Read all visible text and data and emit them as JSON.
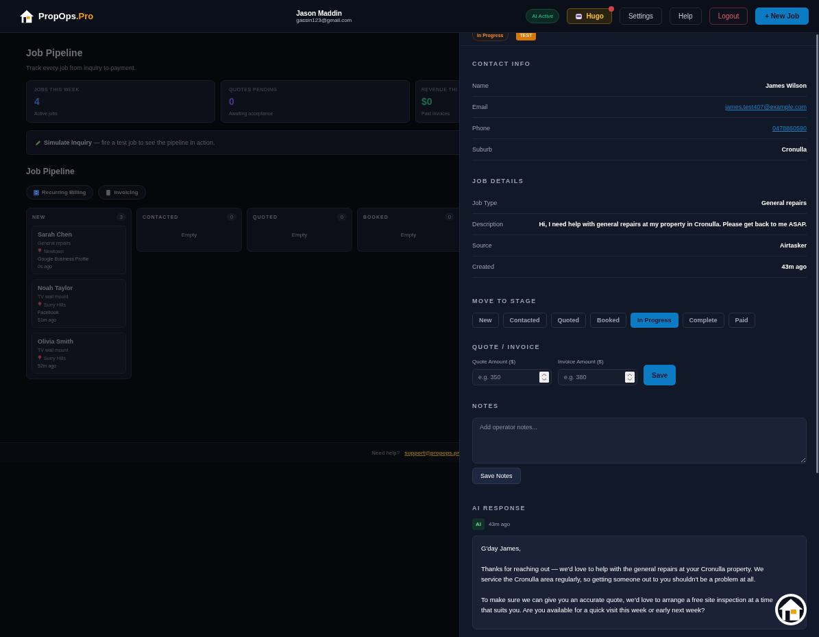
{
  "header": {
    "brand": {
      "name": "PropOps",
      "suffix": ".Pro"
    },
    "user": {
      "name": "Jason Maddin",
      "email": "gassin123@gmail.com"
    },
    "ai_status": "AI Active",
    "assistant": {
      "label": "Hugo",
      "notification": true
    },
    "buttons": [
      {
        "label": "Settings",
        "kind": "plain"
      },
      {
        "label": "Help",
        "kind": "plain"
      },
      {
        "label": "Logout",
        "kind": "danger"
      },
      {
        "label": "+ New Job",
        "kind": "primary"
      }
    ]
  },
  "page": {
    "title": "Job Pipeline",
    "subtitle": "Track every job from inquiry to payment.",
    "stats": [
      {
        "label": "JOBS THIS WEEK",
        "value": "4",
        "caption": "Active jobs",
        "color": "#2a4a8c"
      },
      {
        "label": "QUOTES PENDING",
        "value": "0",
        "caption": "Awaiting acceptance",
        "color": "#4a3590"
      },
      {
        "label": "REVENUE THI",
        "value": "$0",
        "caption": "Paid invoices",
        "color": "#1e6a4a"
      }
    ],
    "simulate": {
      "title": "Simulate Inquiry",
      "text": " — fire a test job to see the pipeline in action."
    },
    "pipeline_title": "Job Pipeline",
    "tabs": [
      {
        "label": "Recurring Billing",
        "kind": "billing"
      },
      {
        "label": "Invoicing",
        "kind": "invoice"
      }
    ],
    "columns": [
      {
        "name": "NEW",
        "count": "3",
        "cards": [
          {
            "name": "Sarah Chen",
            "job_type": "General repairs",
            "suburb": "Newtown",
            "source": "Google Business Profile",
            "time": "0s ago"
          },
          {
            "name": "Noah Taylor",
            "job_type": "TV wall mount",
            "suburb": "Surry Hills",
            "source": "Facebook",
            "time": "51m ago"
          },
          {
            "name": "Olivia Smith",
            "job_type": "TV wall mount",
            "suburb": "Surry Hills",
            "time": "52m ago"
          }
        ]
      },
      {
        "name": "CONTACTED",
        "count": "0",
        "empty_text": "Empty"
      },
      {
        "name": "QUOTED",
        "count": "0",
        "empty_text": "Empty"
      },
      {
        "name": "BOOKED",
        "count": "0",
        "empty_text": "Empty"
      }
    ]
  },
  "footer": {
    "text": "Need help?",
    "link": "support@propops.pr"
  },
  "drawer": {
    "badges": [
      {
        "label": "In Progress",
        "kind": "outline"
      },
      {
        "label": "TEST",
        "kind": "solid"
      }
    ],
    "contact": {
      "title": "CONTACT INFO",
      "rows": [
        {
          "label": "Name",
          "value": "James Wilson",
          "kind": "text"
        },
        {
          "label": "Email",
          "value": "james.test407@example.com",
          "kind": "link"
        },
        {
          "label": "Phone",
          "value": "0478860590",
          "kind": "link"
        },
        {
          "label": "Suburb",
          "value": "Cronulla",
          "kind": "text"
        }
      ]
    },
    "details": {
      "title": "JOB DETAILS",
      "rows": [
        {
          "label": "Job Type",
          "value": "General repairs",
          "kind": "text"
        },
        {
          "label": "Description",
          "value": "Hi, I need help with general repairs at my property in Cronulla. Please get back to me ASAP.",
          "kind": "text"
        },
        {
          "label": "Source",
          "value": "Airtasker",
          "kind": "text"
        },
        {
          "label": "Created",
          "value": "43m ago",
          "kind": "text"
        }
      ]
    },
    "stage": {
      "title": "MOVE TO STAGE",
      "options": [
        {
          "label": "New",
          "selected": false
        },
        {
          "label": "Contacted",
          "selected": false
        },
        {
          "label": "Quoted",
          "selected": false
        },
        {
          "label": "Booked",
          "selected": false
        },
        {
          "label": "In Progress",
          "selected": true
        },
        {
          "label": "Complete",
          "selected": false
        },
        {
          "label": "Paid",
          "selected": false
        }
      ]
    },
    "quote": {
      "title": "QUOTE / INVOICE",
      "fields": [
        {
          "label": "Quote Amount ($)",
          "placeholder": "e.g. 350"
        },
        {
          "label": "Invoice Amount ($)",
          "placeholder": "e.g. 380"
        }
      ],
      "save": "Save"
    },
    "notes": {
      "title": "NOTES",
      "placeholder": "Add operator notes...",
      "save": "Save Notes"
    },
    "ai_response": {
      "title": "AI RESPONSE",
      "badge": "AI",
      "time": "43m ago",
      "paragraphs": [
        "G'day James,",
        "Thanks for reaching out — we'd love to help with the general repairs at your Cronulla property. We service the Cronulla area regularly, so getting someone out to you shouldn't be a problem at all.",
        "To make sure we can give you an accurate quote, we'd love to arrange a free site inspection at a time that suits you. Are you available for a quick visit this week or early next week?"
      ]
    }
  }
}
